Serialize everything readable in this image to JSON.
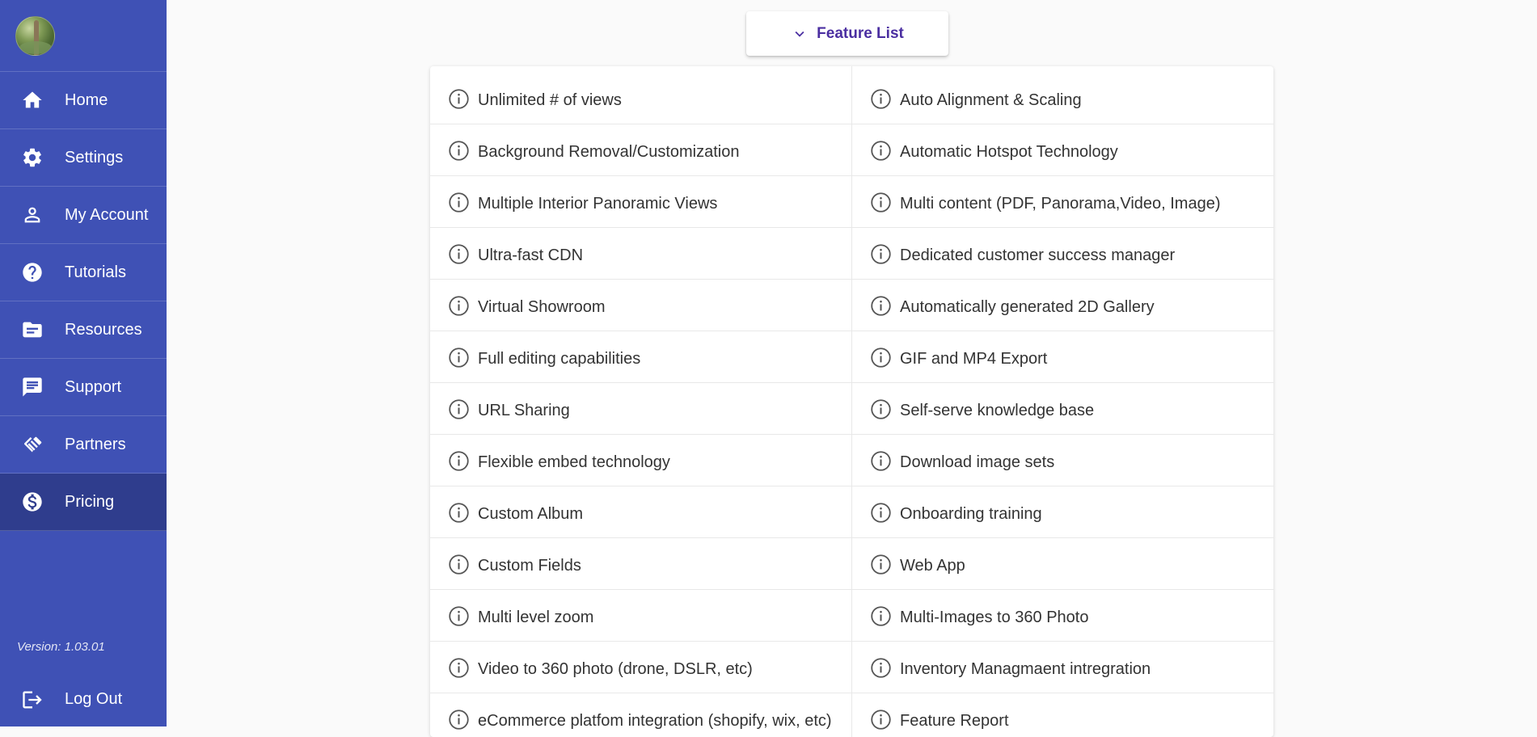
{
  "sidebar": {
    "items": [
      {
        "label": "Home",
        "icon": "home-icon"
      },
      {
        "label": "Settings",
        "icon": "gear-icon"
      },
      {
        "label": "My Account",
        "icon": "person-icon"
      },
      {
        "label": "Tutorials",
        "icon": "help-icon"
      },
      {
        "label": "Resources",
        "icon": "folder-icon"
      },
      {
        "label": "Support",
        "icon": "chat-icon"
      },
      {
        "label": "Partners",
        "icon": "handshake-icon"
      },
      {
        "label": "Pricing",
        "icon": "dollar-icon",
        "active": true
      }
    ],
    "version": "Version: 1.03.01",
    "logout_label": "Log Out",
    "background_color": "#3f51b5",
    "active_color": "#2f3d8d"
  },
  "feature_list": {
    "toggle_label": "Feature List",
    "accent_color": "#4b2fa1",
    "left": [
      "Unlimited # of views",
      "Background Removal/Customization",
      "Multiple Interior Panoramic Views",
      "Ultra-fast CDN",
      "Virtual Showroom",
      "Full editing capabilities",
      "URL Sharing",
      "Flexible embed technology",
      "Custom Album",
      "Custom Fields",
      "Multi level zoom",
      "Video to 360 photo (drone, DSLR, etc)",
      "eCommerce platfom integration (shopify, wix, etc)"
    ],
    "right": [
      "Auto Alignment & Scaling",
      "Automatic Hotspot Technology",
      "Multi content (PDF, Panorama,Video, Image)",
      "Dedicated customer success manager",
      "Automatically generated 2D Gallery",
      "GIF and MP4 Export",
      "Self-serve knowledge base",
      "Download image sets",
      "Onboarding training",
      "Web App",
      "Multi-Images to 360 Photo",
      "Inventory Managmaent intregration",
      "Feature Report"
    ]
  }
}
